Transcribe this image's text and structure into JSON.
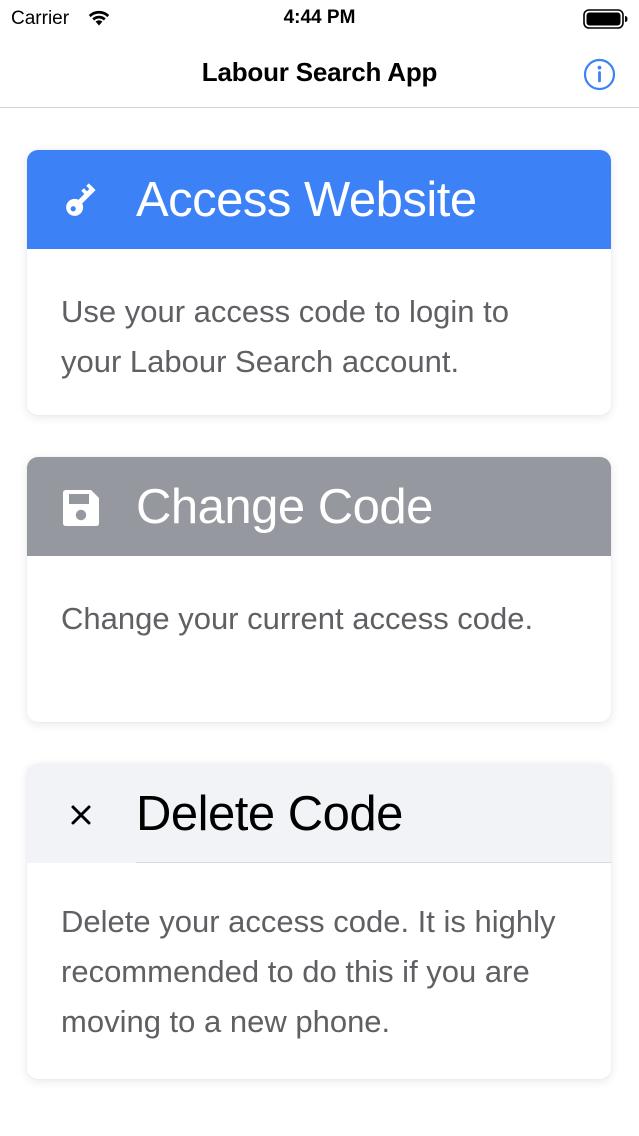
{
  "status_bar": {
    "carrier": "Carrier",
    "time": "4:44 PM",
    "icons": [
      "wifi-icon",
      "battery-icon"
    ]
  },
  "nav": {
    "title": "Labour Search App",
    "info_icon": "info-icon",
    "accent_color": "#3c82f6"
  },
  "cards": [
    {
      "icon": "key-icon",
      "title": "Access Website",
      "description": "Use your access code to login to your Labour Search account.",
      "header_color": "#3c82f6"
    },
    {
      "icon": "floppy-disk-icon",
      "title": "Change Code",
      "description": "Change your current access code.",
      "header_color": "#95989e"
    },
    {
      "icon": "close-icon",
      "title": "Delete Code",
      "description": "Delete your access code. It is highly recommended to do this if you are moving to a new phone.",
      "header_color": "#f2f3f7"
    }
  ]
}
